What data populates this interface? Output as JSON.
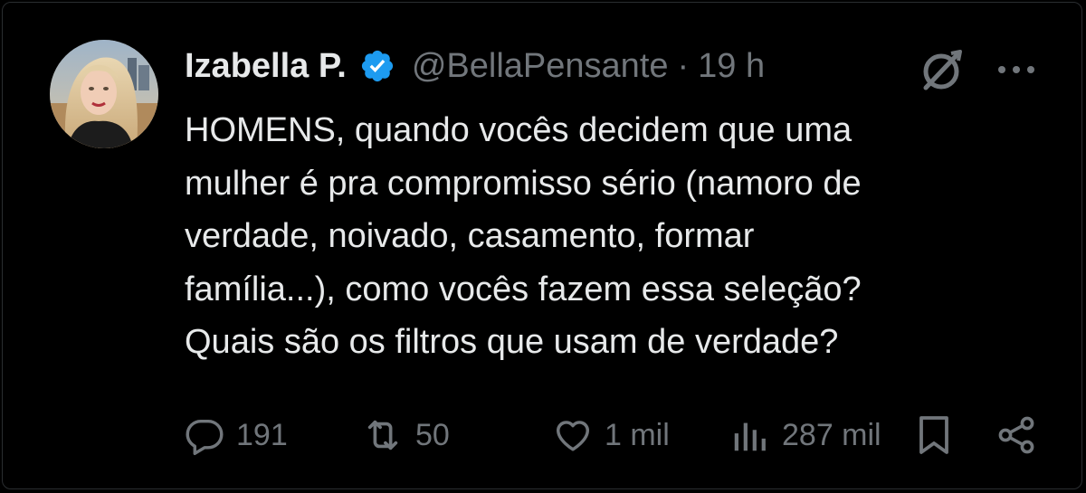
{
  "tweet": {
    "author": {
      "display_name": "Izabella P.",
      "handle": "@BellaPensante",
      "verified": true,
      "avatar": "profile-photo"
    },
    "separator": "·",
    "timestamp": "19 h",
    "text": "HOMENS, quando vocês decidem que uma\nmulher é pra compromisso sério (namoro de\nverdade, noivado, casamento, formar\nfamília...), como vocês fazem essa seleção?\nQuais são os filtros que usam de verdade?",
    "metrics": {
      "replies": "191",
      "reposts": "50",
      "likes": "1 mil",
      "views": "287 mil"
    }
  },
  "icons": {
    "verified": "verified-badge-icon",
    "grok": "grok-icon",
    "more": "more-icon",
    "reply": "reply-icon",
    "repost": "repost-icon",
    "like": "heart-icon",
    "views": "views-icon",
    "bookmark": "bookmark-icon",
    "share": "share-icon"
  },
  "colors": {
    "background": "#000000",
    "text_primary": "#e7e9ea",
    "text_secondary": "#71767b",
    "verified": "#1d9bf0"
  }
}
